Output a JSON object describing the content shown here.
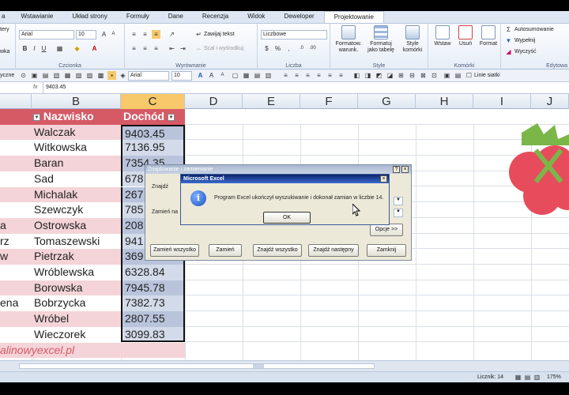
{
  "tabs": [
    "a",
    "Wstawianie",
    "Układ strony",
    "Formuły",
    "Dane",
    "Recenzja",
    "Widok",
    "Deweloper",
    "Projektowanie"
  ],
  "ribbon": {
    "font_name": "Arial",
    "font_size": "10",
    "wrap_text": "Zawijaj tekst",
    "merge_center": "Scal i wyśrodkuj",
    "number_format": "Liczbowe",
    "cond_format": "Formatow. warunk.",
    "format_table": "Formatuj jako tabelę",
    "cell_styles": "Style komórki",
    "insert": "Wstaw",
    "delete": "Usuń",
    "format": "Format",
    "autosum": "Autosumowanie",
    "fill": "Wypełnij",
    "clear": "Wyczyść",
    "group_font": "Czcionka",
    "group_align": "Wyrównanie",
    "group_number": "Liczba",
    "group_style": "Style",
    "group_cells": "Komórki",
    "group_edit": "Edytowa",
    "left_stub_top": "tery",
    "left_stub_bottom": "wka"
  },
  "qbar": {
    "left_text": "yczne",
    "font_name": "Arial",
    "font_size": "10",
    "gridlines": "Linie siatki"
  },
  "formula": {
    "fx": "fx",
    "value": "9403.45"
  },
  "columns": [
    "B",
    "C",
    "D",
    "E",
    "F",
    "G",
    "H",
    "I",
    "J"
  ],
  "table": {
    "header_b": "Nazwisko",
    "header_c": "Dochód",
    "rows": [
      {
        "a": "",
        "b": "Walczak",
        "c": "9403.45"
      },
      {
        "a": "",
        "b": "Witkowska",
        "c": "7136.95"
      },
      {
        "a": "",
        "b": "Baran",
        "c": "7354.35"
      },
      {
        "a": "",
        "b": "Sad",
        "c": "678"
      },
      {
        "a": "",
        "b": "Michalak",
        "c": "267"
      },
      {
        "a": "",
        "b": "Szewczyk",
        "c": "785"
      },
      {
        "a": "a",
        "b": "Ostrowska",
        "c": "208"
      },
      {
        "a": "rz",
        "b": "Tomaszewski",
        "c": "941"
      },
      {
        "a": "w",
        "b": "Pietrzak",
        "c": "369"
      },
      {
        "a": "",
        "b": "Wróblewska",
        "c": "6328.84"
      },
      {
        "a": "",
        "b": "Borowska",
        "c": "7945.78"
      },
      {
        "a": "ena",
        "b": "Bobrzycka",
        "c": "7382.73"
      },
      {
        "a": "",
        "b": "Wróbel",
        "c": "2807.55"
      },
      {
        "a": "",
        "b": "Wieczorek",
        "c": "3099.83"
      }
    ],
    "footer_link": "alinowyexcel.pl"
  },
  "status": {
    "count": "Licznik: 14",
    "zoom": "175%"
  },
  "find_dialog": {
    "title": "Znajdowanie i zamienianie",
    "find_label": "Znajdź",
    "replace_label": "Zamień na",
    "options_btn": "Opcje >>",
    "btn_replace_all": "Zamień wszystko",
    "btn_replace": "Zamień",
    "btn_find_all": "Znajdź wszystko",
    "btn_find_next": "Znajdź następny",
    "btn_close": "Zamknij",
    "help_btn": "?",
    "close_btn": "×"
  },
  "msgbox": {
    "title": "Microsoft Excel",
    "message": "Program Excel ukończył wyszukiwanie i dokonał zamian w liczbie 14.",
    "ok": "OK",
    "close_btn": "×",
    "info_glyph": "i"
  },
  "colors": {
    "header_red": "#d65a66",
    "row_pink": "#f4d4d8",
    "selection_blue": "#b9c4dc",
    "accent_orange": "#f7c96b",
    "raspberry": "#e74c5c",
    "leaf_green": "#7ab648"
  }
}
